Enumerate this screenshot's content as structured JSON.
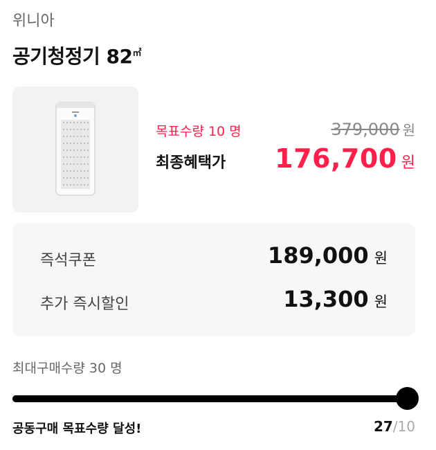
{
  "brand": "위니아",
  "product": {
    "title": "공기청정기 82",
    "title_unit": "㎡"
  },
  "deal": {
    "target_text": "목표수량 10 명",
    "original_price": "379,000",
    "final_label": "최종혜택가",
    "final_price": "176,700",
    "currency": "원"
  },
  "benefits": [
    {
      "label": "즉석쿠폰",
      "amount": "189,000",
      "currency": "원"
    },
    {
      "label": "추가 즉시할인",
      "amount": "13,300",
      "currency": "원"
    }
  ],
  "max_purchase": "최대구매수량 30 명",
  "progress": {
    "fraction": 1.0,
    "message": "공동구매 목표수량 달성!",
    "current": "27",
    "separator": "/",
    "target": "10"
  },
  "colors": {
    "accent": "#ff1f4b",
    "track": "#000000",
    "panel": "#f7f7f7"
  }
}
